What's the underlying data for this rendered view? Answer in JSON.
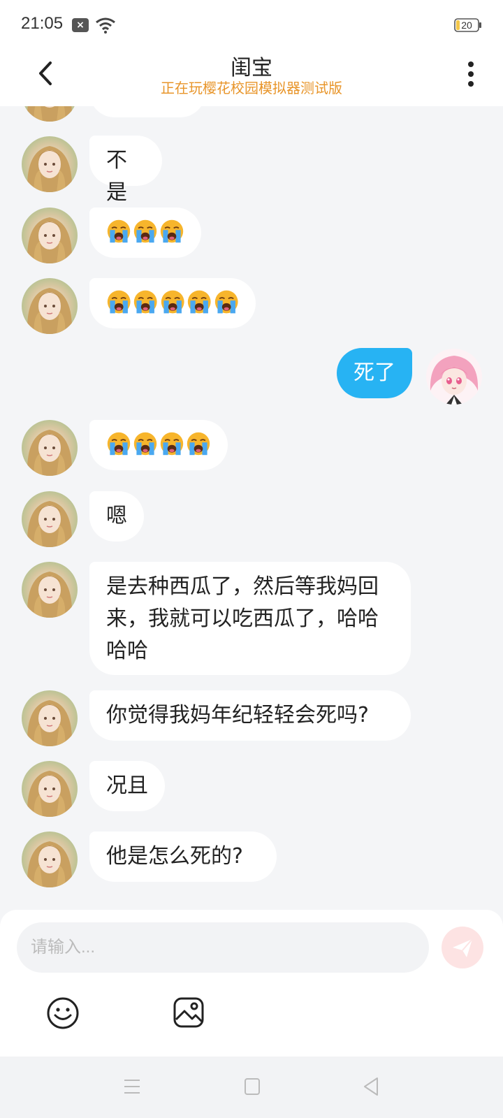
{
  "status_bar": {
    "time": "21:05",
    "battery": "20"
  },
  "header": {
    "title": "闺宝",
    "subtitle": "正在玩樱花校园模拟器测试版"
  },
  "messages": [
    {
      "sender": "them",
      "text": "不是"
    },
    {
      "sender": "them",
      "emoji": "crying-face",
      "count": 3
    },
    {
      "sender": "them",
      "emoji": "crying-face",
      "count": 5
    },
    {
      "sender": "me",
      "text": "死了"
    },
    {
      "sender": "them",
      "emoji": "crying-face",
      "count": 4
    },
    {
      "sender": "them",
      "text": "嗯"
    },
    {
      "sender": "them",
      "lines": [
        "是去种西瓜了，然后等我妈回",
        "来，我就可以吃西瓜了，哈哈",
        "哈哈"
      ]
    },
    {
      "sender": "them",
      "text": "你觉得我妈年纪轻轻会死吗?"
    },
    {
      "sender": "them",
      "text": "况且"
    },
    {
      "sender": "them",
      "text": "他是怎么死的?"
    }
  ],
  "input": {
    "placeholder": "请输入..."
  },
  "icons": {
    "back": "chevron-left-icon",
    "more": "more-vert-icon",
    "send": "send-icon",
    "emoji": "smiley-icon",
    "image": "image-icon",
    "nav_menu": "menu-icon",
    "nav_home": "home-icon",
    "nav_back": "back-triangle-icon"
  },
  "colors": {
    "my_bubble": "#27b3f3",
    "subtitle": "#e8952a",
    "send_button": "#fde3e3"
  }
}
